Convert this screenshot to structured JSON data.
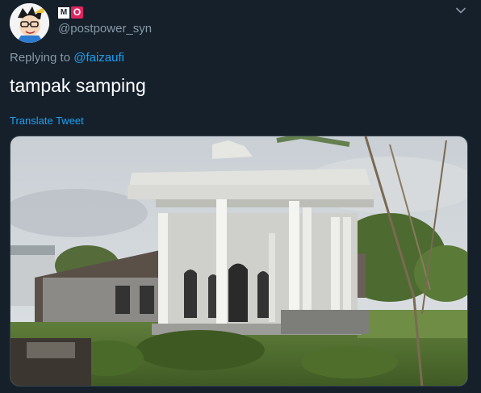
{
  "author": {
    "badge_left": "M",
    "badge_right": "O",
    "handle": "@postpower_syn"
  },
  "reply": {
    "prefix": "Replying to",
    "mention": "@faizaufi"
  },
  "tweet": {
    "text": "tampak samping",
    "translate_label": "Translate Tweet"
  },
  "icons": {
    "menu": "chevron-down-icon",
    "avatar": "cartoon-avatar"
  },
  "colors": {
    "background": "#15202b",
    "accent": "#1da1f2",
    "secondary_text": "#8899a6"
  }
}
